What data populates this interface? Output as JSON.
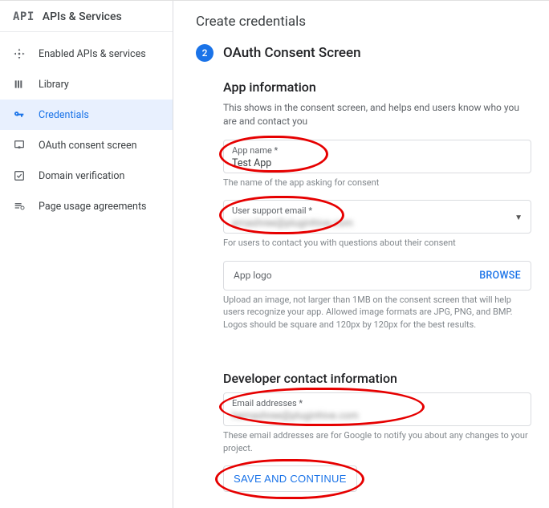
{
  "sidebar": {
    "logo": "API",
    "title": "APIs & Services",
    "items": [
      {
        "label": "Enabled APIs & services"
      },
      {
        "label": "Library"
      },
      {
        "label": "Credentials"
      },
      {
        "label": "OAuth consent screen"
      },
      {
        "label": "Domain verification"
      },
      {
        "label": "Page usage agreements"
      }
    ]
  },
  "page": {
    "title": "Create credentials",
    "step_number": "2",
    "step_title": "OAuth Consent Screen"
  },
  "app_info": {
    "heading": "App information",
    "desc": "This shows in the consent screen, and helps end users know who you are and contact you",
    "app_name_label": "App name *",
    "app_name_value": "Test App",
    "app_name_helper": "The name of the app asking for consent",
    "support_label": "User support email *",
    "support_value": "emashree@pluginhive.com",
    "support_helper": "For users to contact you with questions about their consent",
    "logo_label": "App logo",
    "browse_label": "BROWSE",
    "logo_helper": "Upload an image, not larger than 1MB on the consent screen that will help users recognize your app. Allowed image formats are JPG, PNG, and BMP. Logos should be square and 120px by 120px for the best results."
  },
  "dev_info": {
    "heading": "Developer contact information",
    "email_label": "Email addresses *",
    "email_value": "hemashree@pluginhive.com",
    "email_helper": "These email addresses are for Google to notify you about any changes to your project."
  },
  "actions": {
    "save": "SAVE AND CONTINUE"
  }
}
